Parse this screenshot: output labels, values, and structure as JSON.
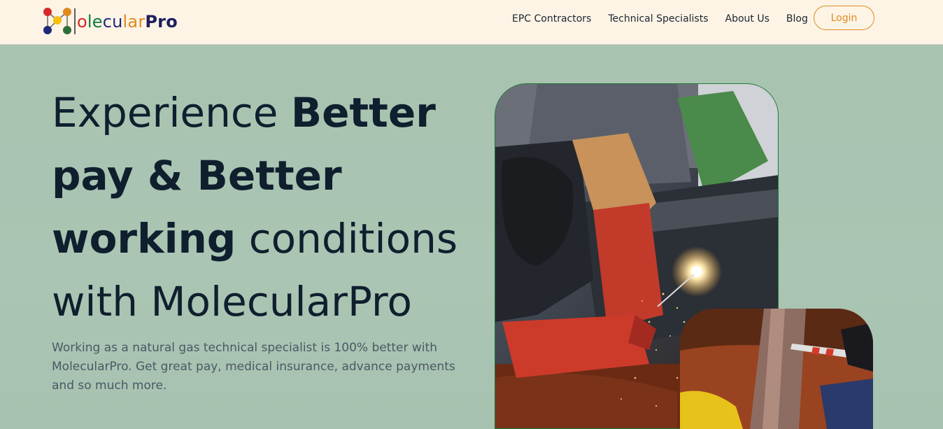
{
  "brand": {
    "name_parts": [
      "o",
      "le",
      "cu",
      "lar",
      "Pro"
    ],
    "colors": {
      "red": "#d62a2a",
      "green": "#0d7a3e",
      "navy": "#1e2a78",
      "orange": "#e08a1e",
      "dark": "#1d1f5e"
    }
  },
  "nav": {
    "items": [
      "EPC Contractors",
      "Technical Specialists",
      "About Us",
      "Blog"
    ],
    "login_label": "Login"
  },
  "hero": {
    "title_part1": "Experience ",
    "title_bold1": "Better pay & Better working",
    "title_part2": " conditions with MolecularPro",
    "subtitle": "Working as a natural gas technical specialist is 100% better with MolecularPro. Get great pay, medical insurance, advance payments and so much more."
  },
  "images": {
    "main_icon": "welding-photo",
    "secondary_icon": "pipeline-photo"
  },
  "theme": {
    "accent": "#e08a1e",
    "hero_bg": "#a9c3b1",
    "header_bg": "#fdf4e6"
  }
}
